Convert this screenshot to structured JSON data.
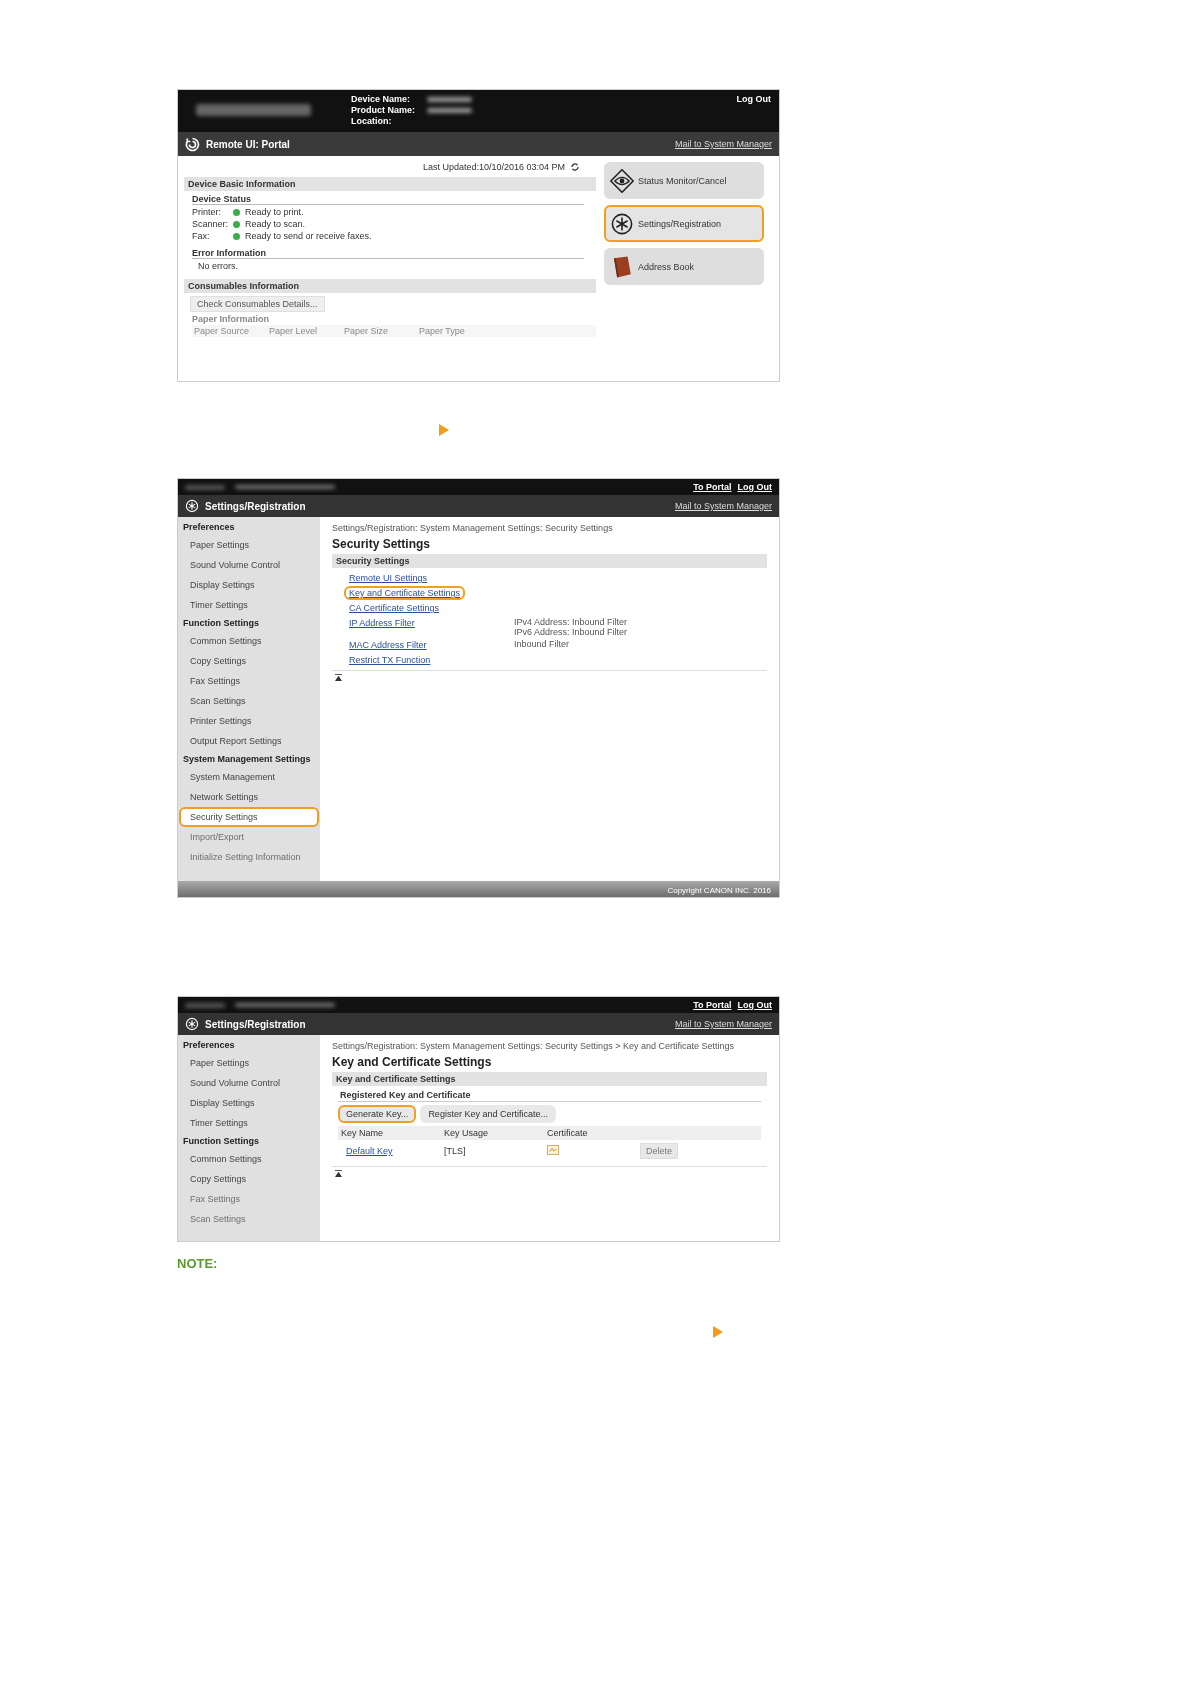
{
  "screens": [
    {
      "kind": "portal",
      "device_labels": [
        "Device Name:",
        "Product Name:",
        "Location:"
      ],
      "logout": "Log Out",
      "title": "Remote UI: Portal",
      "mail": "Mail to System Manager",
      "last_updated": "Last Updated:10/10/2016 03:04 PM",
      "basic": {
        "title": "Device Basic Information",
        "status_title": "Device Status",
        "status_rows": [
          {
            "label": "Printer:",
            "status": "Ready to print."
          },
          {
            "label": "Scanner:",
            "status": "Ready to scan."
          },
          {
            "label": "Fax:",
            "status": "Ready to send or receive faxes."
          }
        ],
        "error_title": "Error Information",
        "error_text": "No errors."
      },
      "consumables": {
        "title": "Consumables Information",
        "button": "Check Consumables Details...",
        "paper_title": "Paper Information",
        "columns": [
          "Paper Source",
          "Paper Level",
          "Paper Size",
          "Paper Type"
        ]
      },
      "menu": [
        {
          "label": "Status Monitor/Cancel",
          "highlighted": false
        },
        {
          "label": "Settings/Registration",
          "highlighted": true
        },
        {
          "label": "Address Book",
          "highlighted": false
        }
      ]
    },
    {
      "kind": "settings",
      "top_links": [
        "To Portal",
        "Log Out"
      ],
      "title": "Settings/Registration",
      "mail": "Mail to System Manager",
      "sidebar": [
        {
          "label": "Preferences",
          "items": [
            {
              "label": "Paper Settings",
              "highlighted": false,
              "faded": false
            },
            {
              "label": "Sound Volume Control",
              "highlighted": false,
              "faded": false
            },
            {
              "label": "Display Settings",
              "highlighted": false,
              "faded": false
            },
            {
              "label": "Timer Settings",
              "highlighted": false,
              "faded": false
            }
          ]
        },
        {
          "label": "Function Settings",
          "items": [
            {
              "label": "Common Settings",
              "highlighted": false,
              "faded": false
            },
            {
              "label": "Copy Settings",
              "highlighted": false,
              "faded": false
            },
            {
              "label": "Fax Settings",
              "highlighted": false,
              "faded": false
            },
            {
              "label": "Scan Settings",
              "highlighted": false,
              "faded": false
            },
            {
              "label": "Printer Settings",
              "highlighted": false,
              "faded": false
            },
            {
              "label": "Output Report Settings",
              "highlighted": false,
              "faded": false
            }
          ]
        },
        {
          "label": "System Management Settings",
          "items": [
            {
              "label": "System Management",
              "highlighted": false,
              "faded": false
            },
            {
              "label": "Network Settings",
              "highlighted": false,
              "faded": false
            },
            {
              "label": "Security Settings",
              "highlighted": true,
              "faded": false
            },
            {
              "label": "Import/Export",
              "highlighted": false,
              "faded": true
            },
            {
              "label": "Initialize Setting Information",
              "highlighted": false,
              "faded": true
            }
          ]
        }
      ],
      "breadcrumb": "Settings/Registration: System Management Settings: Security Settings",
      "heading": "Security Settings",
      "section": "Security Settings",
      "content": {
        "kind": "links",
        "links": [
          {
            "label": "Remote UI Settings",
            "highlighted": false
          },
          {
            "label": "Key and Certificate Settings",
            "highlighted": true
          },
          {
            "label": "CA Certificate Settings",
            "highlighted": false
          },
          {
            "label": "IP Address Filter",
            "highlighted": false,
            "notes": [
              "IPv4 Address: Inbound Filter",
              "IPv6 Address: Inbound Filter"
            ]
          },
          {
            "label": "MAC Address Filter",
            "highlighted": false,
            "notes": [
              "Inbound Filter"
            ]
          },
          {
            "label": "Restrict TX Function",
            "highlighted": false
          }
        ]
      },
      "footer": "Copyright CANON INC. 2016"
    },
    {
      "kind": "settings",
      "top_links": [
        "To Portal",
        "Log Out"
      ],
      "title": "Settings/Registration",
      "mail": "Mail to System Manager",
      "sidebar": [
        {
          "label": "Preferences",
          "items": [
            {
              "label": "Paper Settings",
              "highlighted": false,
              "faded": false
            },
            {
              "label": "Sound Volume Control",
              "highlighted": false,
              "faded": false
            },
            {
              "label": "Display Settings",
              "highlighted": false,
              "faded": false
            },
            {
              "label": "Timer Settings",
              "highlighted": false,
              "faded": false
            }
          ]
        },
        {
          "label": "Function Settings",
          "items": [
            {
              "label": "Common Settings",
              "highlighted": false,
              "faded": false
            },
            {
              "label": "Copy Settings",
              "highlighted": false,
              "faded": false
            },
            {
              "label": "Fax Settings",
              "highlighted": false,
              "faded": true
            },
            {
              "label": "Scan Settings",
              "highlighted": false,
              "faded": true
            }
          ]
        }
      ],
      "breadcrumb": "Settings/Registration: System Management Settings: Security Settings > Key and Certificate Settings",
      "heading": "Key and Certificate Settings",
      "section": "Key and Certificate Settings",
      "content": {
        "kind": "keys",
        "subheading": "Registered Key and Certificate",
        "buttons": [
          {
            "label": "Generate Key...",
            "highlighted": true
          },
          {
            "label": "Register Key and Certificate...",
            "highlighted": false
          }
        ],
        "columns": [
          "Key Name",
          "Key Usage",
          "Certificate"
        ],
        "rows": [
          {
            "key_name": "Default Key",
            "usage": "[TLS]",
            "delete": "Delete",
            "delete_disabled": true
          }
        ]
      }
    }
  ],
  "note": {
    "label": "NOTE:"
  }
}
